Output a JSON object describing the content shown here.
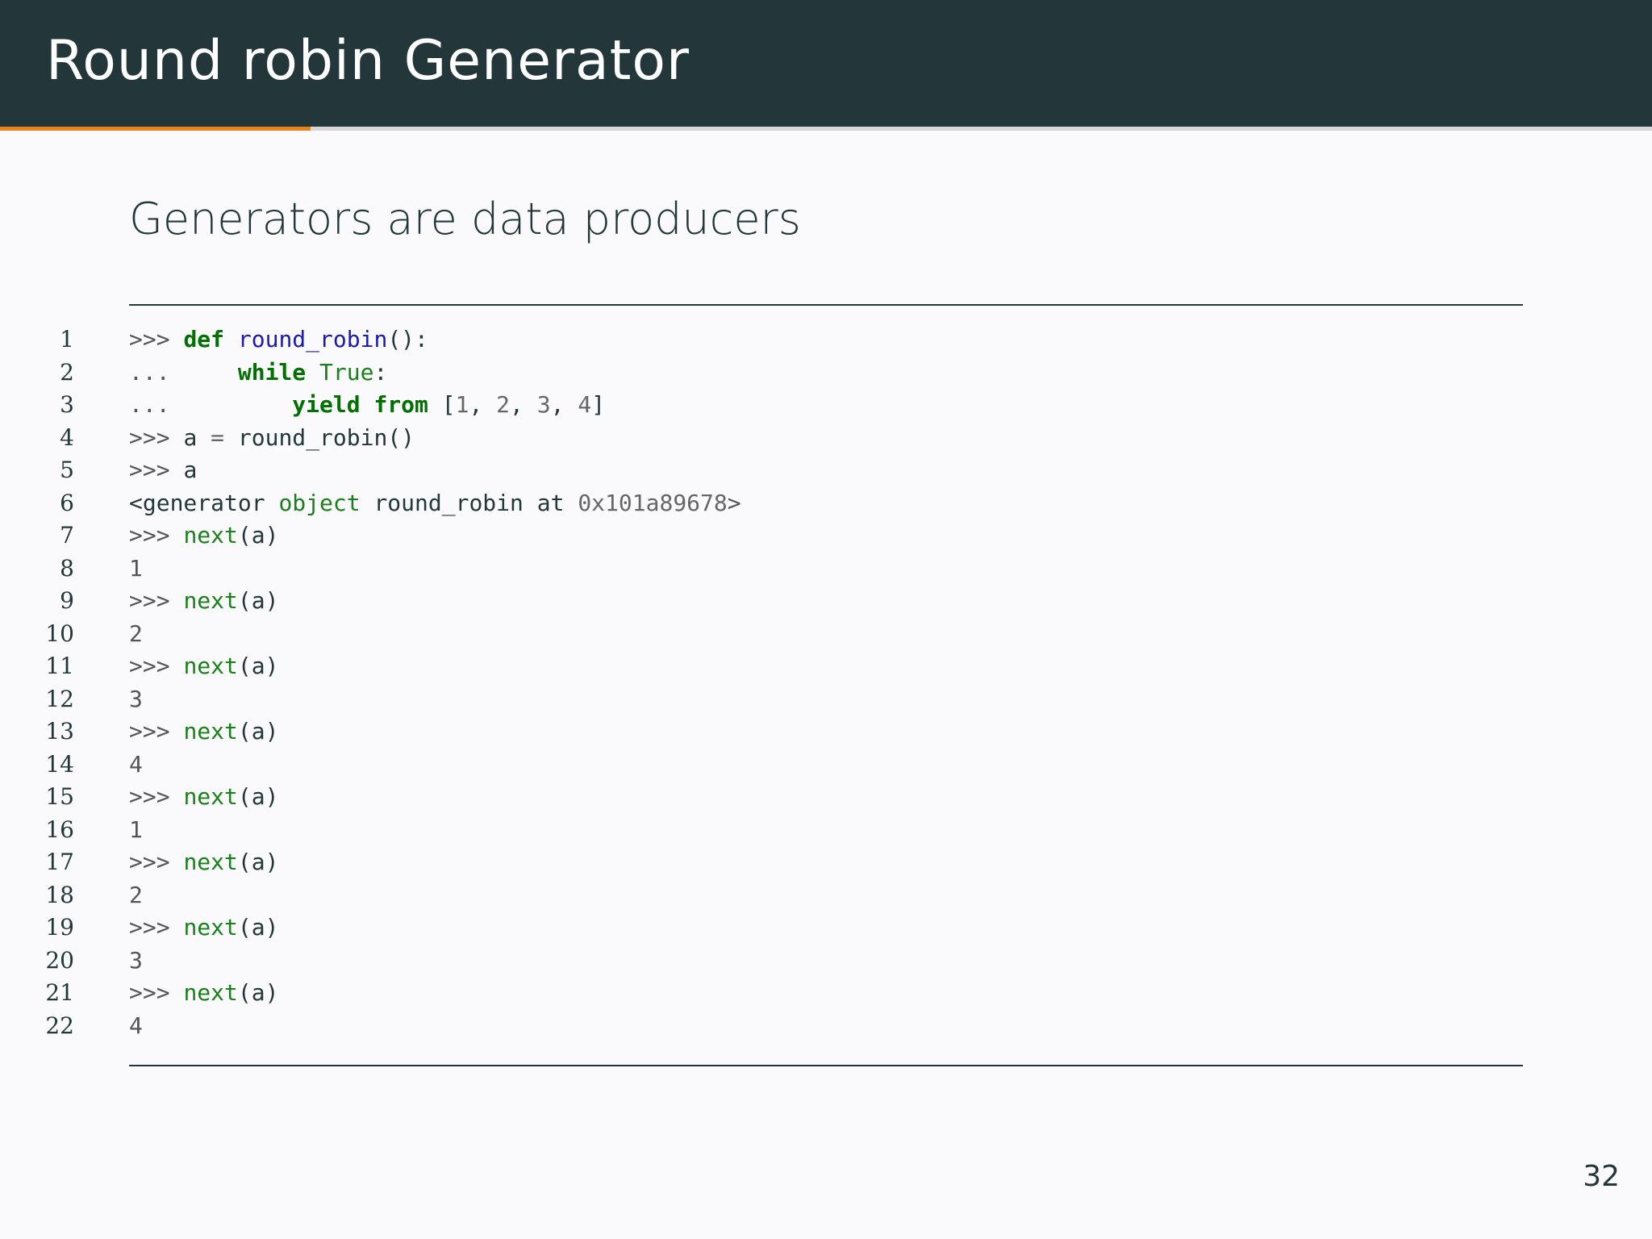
{
  "header": {
    "title": "Round robin Generator",
    "progress_fraction": 0.188
  },
  "section": {
    "heading": "Generators are data producers"
  },
  "code_lines": [
    {
      "n": "1",
      "tokens": [
        {
          "t": ">>> ",
          "c": "prompt"
        },
        {
          "t": "def",
          "c": "kw"
        },
        {
          "t": " ",
          "c": "plain"
        },
        {
          "t": "round_robin",
          "c": "fn"
        },
        {
          "t": "():",
          "c": "plain"
        }
      ]
    },
    {
      "n": "2",
      "tokens": [
        {
          "t": "...     ",
          "c": "prompt"
        },
        {
          "t": "while",
          "c": "kw"
        },
        {
          "t": " ",
          "c": "plain"
        },
        {
          "t": "True",
          "c": "builtin"
        },
        {
          "t": ":",
          "c": "plain"
        }
      ]
    },
    {
      "n": "3",
      "tokens": [
        {
          "t": "...         ",
          "c": "prompt"
        },
        {
          "t": "yield from",
          "c": "kw"
        },
        {
          "t": " [",
          "c": "plain"
        },
        {
          "t": "1",
          "c": "num"
        },
        {
          "t": ", ",
          "c": "plain"
        },
        {
          "t": "2",
          "c": "num"
        },
        {
          "t": ", ",
          "c": "plain"
        },
        {
          "t": "3",
          "c": "num"
        },
        {
          "t": ", ",
          "c": "plain"
        },
        {
          "t": "4",
          "c": "num"
        },
        {
          "t": "]",
          "c": "plain"
        }
      ]
    },
    {
      "n": "4",
      "tokens": [
        {
          "t": ">>> ",
          "c": "prompt"
        },
        {
          "t": "a ",
          "c": "plain"
        },
        {
          "t": "=",
          "c": "num"
        },
        {
          "t": " round_robin()",
          "c": "plain"
        }
      ]
    },
    {
      "n": "5",
      "tokens": [
        {
          "t": ">>> ",
          "c": "prompt"
        },
        {
          "t": "a",
          "c": "plain"
        }
      ]
    },
    {
      "n": "6",
      "tokens": [
        {
          "t": "<generator ",
          "c": "plain"
        },
        {
          "t": "object",
          "c": "builtin"
        },
        {
          "t": " round_robin at ",
          "c": "plain"
        },
        {
          "t": "0x101a89678",
          "c": "num"
        },
        {
          "t": ">",
          "c": "prompt"
        }
      ]
    },
    {
      "n": "7",
      "tokens": [
        {
          "t": ">>> ",
          "c": "prompt"
        },
        {
          "t": "next",
          "c": "builtin"
        },
        {
          "t": "(a)",
          "c": "plain"
        }
      ]
    },
    {
      "n": "8",
      "tokens": [
        {
          "t": "1",
          "c": "out"
        }
      ]
    },
    {
      "n": "9",
      "tokens": [
        {
          "t": ">>> ",
          "c": "prompt"
        },
        {
          "t": "next",
          "c": "builtin"
        },
        {
          "t": "(a)",
          "c": "plain"
        }
      ]
    },
    {
      "n": "10",
      "tokens": [
        {
          "t": "2",
          "c": "out"
        }
      ]
    },
    {
      "n": "11",
      "tokens": [
        {
          "t": ">>> ",
          "c": "prompt"
        },
        {
          "t": "next",
          "c": "builtin"
        },
        {
          "t": "(a)",
          "c": "plain"
        }
      ]
    },
    {
      "n": "12",
      "tokens": [
        {
          "t": "3",
          "c": "out"
        }
      ]
    },
    {
      "n": "13",
      "tokens": [
        {
          "t": ">>> ",
          "c": "prompt"
        },
        {
          "t": "next",
          "c": "builtin"
        },
        {
          "t": "(a)",
          "c": "plain"
        }
      ]
    },
    {
      "n": "14",
      "tokens": [
        {
          "t": "4",
          "c": "out"
        }
      ]
    },
    {
      "n": "15",
      "tokens": [
        {
          "t": ">>> ",
          "c": "prompt"
        },
        {
          "t": "next",
          "c": "builtin"
        },
        {
          "t": "(a)",
          "c": "plain"
        }
      ]
    },
    {
      "n": "16",
      "tokens": [
        {
          "t": "1",
          "c": "out"
        }
      ]
    },
    {
      "n": "17",
      "tokens": [
        {
          "t": ">>> ",
          "c": "prompt"
        },
        {
          "t": "next",
          "c": "builtin"
        },
        {
          "t": "(a)",
          "c": "plain"
        }
      ]
    },
    {
      "n": "18",
      "tokens": [
        {
          "t": "2",
          "c": "out"
        }
      ]
    },
    {
      "n": "19",
      "tokens": [
        {
          "t": ">>> ",
          "c": "prompt"
        },
        {
          "t": "next",
          "c": "builtin"
        },
        {
          "t": "(a)",
          "c": "plain"
        }
      ]
    },
    {
      "n": "20",
      "tokens": [
        {
          "t": "3",
          "c": "out"
        }
      ]
    },
    {
      "n": "21",
      "tokens": [
        {
          "t": ">>> ",
          "c": "prompt"
        },
        {
          "t": "next",
          "c": "builtin"
        },
        {
          "t": "(a)",
          "c": "plain"
        }
      ]
    },
    {
      "n": "22",
      "tokens": [
        {
          "t": "4",
          "c": "out"
        }
      ]
    }
  ],
  "footer": {
    "page_number": "32"
  },
  "colors": {
    "header_bg": "#23373b",
    "accent": "#eb811b",
    "background": "#fafafc"
  }
}
